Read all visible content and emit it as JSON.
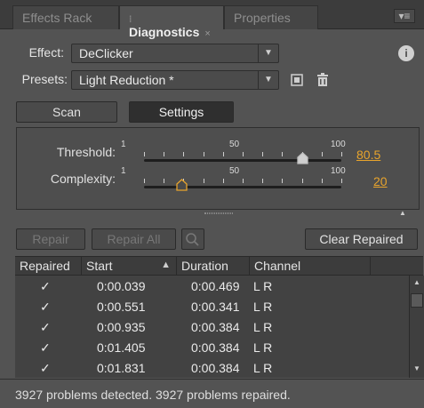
{
  "tabs": [
    {
      "label": "Effects Rack",
      "active": false
    },
    {
      "label": "Diagnostics",
      "active": true,
      "close": "×"
    },
    {
      "label": "Properties",
      "active": false
    }
  ],
  "panel_menu_icon": "▾≡",
  "effect": {
    "label": "Effect:",
    "value": "DeClicker",
    "info_icon": "i"
  },
  "presets": {
    "label": "Presets:",
    "value": "Light Reduction *"
  },
  "mode_buttons": {
    "scan": "Scan",
    "settings": "Settings",
    "selected": "Settings"
  },
  "sliders": [
    {
      "label": "Threshold:",
      "min": "1",
      "mid": "50",
      "max": "100",
      "value": "80.5",
      "level": 0.8
    },
    {
      "label": "Complexity:",
      "min": "1",
      "mid": "50",
      "max": "100",
      "value": "20",
      "level": 0.19
    }
  ],
  "actions": {
    "repair": "Repair",
    "repair_all": "Repair All",
    "clear_repaired": "Clear Repaired"
  },
  "table": {
    "headers": [
      "Repaired",
      "Start",
      "Duration",
      "Channel"
    ],
    "rows": [
      {
        "repaired": "✓",
        "start": "0:00.039",
        "duration": "0:00.469",
        "channel": "L R"
      },
      {
        "repaired": "✓",
        "start": "0:00.551",
        "duration": "0:00.341",
        "channel": "L R"
      },
      {
        "repaired": "✓",
        "start": "0:00.935",
        "duration": "0:00.384",
        "channel": "L R"
      },
      {
        "repaired": "✓",
        "start": "0:01.405",
        "duration": "0:00.384",
        "channel": "L R"
      },
      {
        "repaired": "✓",
        "start": "0:01.831",
        "duration": "0:00.384",
        "channel": "L R"
      }
    ]
  },
  "status": "3927 problems detected. 3927 problems repaired.",
  "colors": {
    "accent": "#e8a42c",
    "panel": "#535353",
    "tabbar": "#3c3c3c"
  }
}
